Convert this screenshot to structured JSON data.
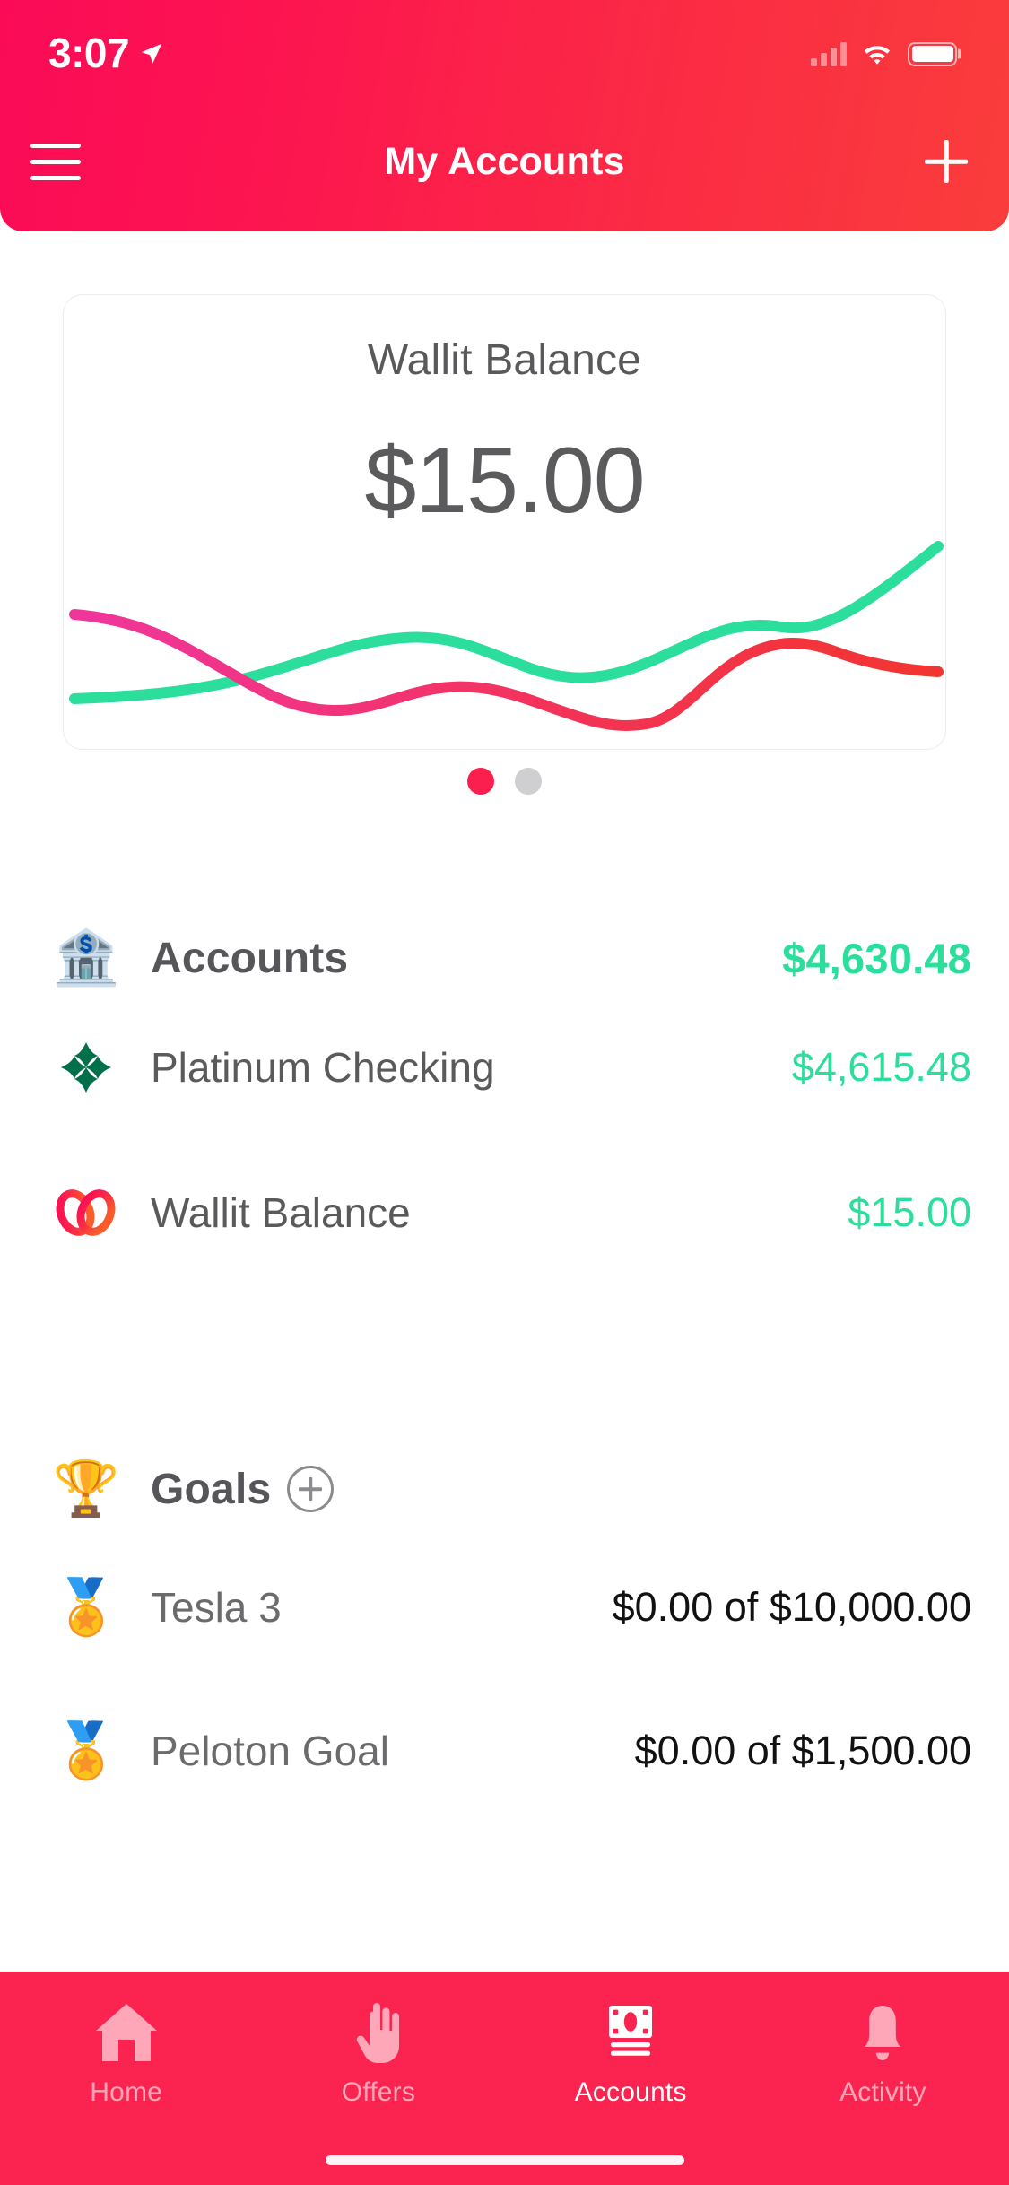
{
  "status_bar": {
    "time": "3:07",
    "location_icon": "location-arrow-icon",
    "signal_icon": "cellular-signal-icon",
    "wifi_icon": "wifi-icon",
    "battery_icon": "battery-full-icon"
  },
  "header": {
    "title": "My Accounts",
    "menu_icon": "hamburger-menu-icon",
    "add_icon": "plus-icon",
    "gradient_from": "#FB0B57",
    "gradient_to": "#FA3D3B"
  },
  "balance_card": {
    "title": "Wallit Balance",
    "amount": "$15.00"
  },
  "pager": {
    "total": 2,
    "active_index": 0,
    "active_color": "#FB1F4F",
    "inactive_color": "#CFCFD2"
  },
  "accounts_section": {
    "icon": "🏦",
    "icon_name": "bank-emoji",
    "label": "Accounts",
    "total": "$4,630.48",
    "total_color": "#2BDE9B",
    "items": [
      {
        "icon_name": "bbt-bank-logo",
        "label": "Platinum Checking",
        "value": "$4,615.48",
        "value_color": "#2BDE9B",
        "logo_color": "#00704A"
      },
      {
        "icon_name": "wallit-logo",
        "label": "Wallit Balance",
        "value": "$15.00",
        "value_color": "#2BDE9B",
        "logo_color_from": "#FB0B57",
        "logo_color_to": "#FA4A30"
      }
    ]
  },
  "goals_section": {
    "icon": "🏆",
    "icon_name": "trophy-emoji",
    "label": "Goals",
    "add_icon": "circle-plus-icon",
    "items": [
      {
        "icon": "🏅",
        "icon_name": "sports-medal-emoji",
        "label": "Tesla 3",
        "value": "$0.00 of $10,000.00"
      },
      {
        "icon": "🏅",
        "icon_name": "sports-medal-emoji",
        "label": "Peloton Goal",
        "value": "$0.00 of $1,500.00"
      }
    ]
  },
  "tab_bar": {
    "background": "#FB2350",
    "active_index": 2,
    "tabs": [
      {
        "label": "Home",
        "icon_name": "home-icon",
        "active": false
      },
      {
        "label": "Offers",
        "icon_name": "hand-icon",
        "active": false
      },
      {
        "label": "Accounts",
        "icon_name": "banknote-icon",
        "active": true
      },
      {
        "label": "Activity",
        "icon_name": "bell-icon",
        "active": false
      }
    ]
  },
  "chart_data": {
    "type": "line",
    "title": "Wallit Balance sparkline",
    "xlabel": "",
    "ylabel": "",
    "grid": false,
    "legend": "none",
    "x": [
      0,
      1,
      2,
      3,
      4,
      5,
      6,
      7,
      8,
      9,
      10
    ],
    "xlim": [
      0,
      10
    ],
    "ylim": [
      0,
      100
    ],
    "series": [
      {
        "name": "green-trend",
        "color": "#2BDE9B",
        "values": [
          18,
          19,
          22,
          35,
          45,
          44,
          34,
          28,
          33,
          52,
          92
        ]
      },
      {
        "name": "pink-red-trend",
        "color_from": "#F0369B",
        "color_to": "#F2352F",
        "values": [
          62,
          57,
          41,
          26,
          24,
          32,
          34,
          24,
          17,
          52,
          56,
          47
        ]
      }
    ]
  }
}
